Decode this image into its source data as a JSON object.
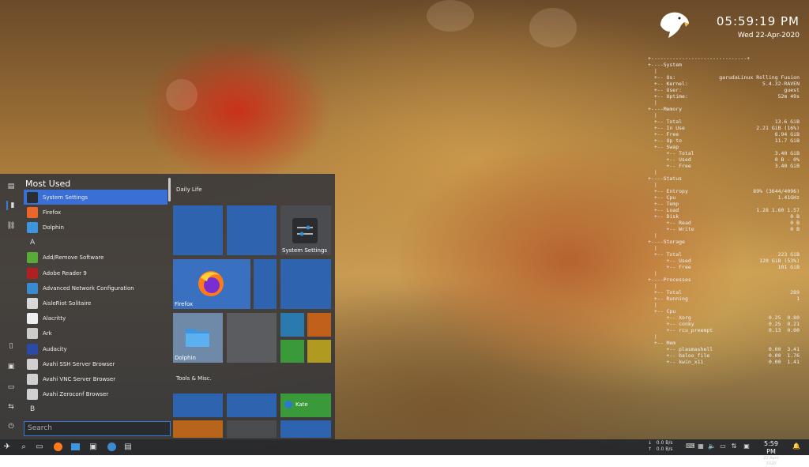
{
  "desktop": {
    "clock_time": "05:59:19 PM",
    "clock_date": "Wed 22-Apr-2020"
  },
  "conky": {
    "rows": [
      {
        "l": "+-------------------------------+",
        "r": ""
      },
      {
        "l": "+----System",
        "r": ""
      },
      {
        "l": "  |",
        "r": ""
      },
      {
        "l": "  +-- Os:",
        "r": "garudaLinux Rolling Fusion"
      },
      {
        "l": "  +-- Kernel:",
        "r": "5.4.32-RAVEN"
      },
      {
        "l": "  +-- User:",
        "r": "guest"
      },
      {
        "l": "  +-- Uptime:",
        "r": "52m 49s"
      },
      {
        "l": "  |",
        "r": ""
      },
      {
        "l": "+----Memory",
        "r": ""
      },
      {
        "l": "  |",
        "r": ""
      },
      {
        "l": "  +-- Total",
        "r": "13.6 GiB"
      },
      {
        "l": "  +-- In Use",
        "r": "2.21 GiB (16%)"
      },
      {
        "l": "  +-- Free",
        "r": "6.94 GiB"
      },
      {
        "l": "  +-- Up to",
        "r": "11.7 GiB"
      },
      {
        "l": "  +-- Swap",
        "r": ""
      },
      {
        "l": "      +-- Total",
        "r": "3.40 GiB"
      },
      {
        "l": "      +-- Used",
        "r": "0 B - 0%"
      },
      {
        "l": "      +-- Free",
        "r": "3.40 GiB"
      },
      {
        "l": "  |",
        "r": ""
      },
      {
        "l": "+----Status",
        "r": ""
      },
      {
        "l": "  |",
        "r": ""
      },
      {
        "l": "  +-- Entropy",
        "r": "89% (3644/4096)"
      },
      {
        "l": "  +-- Cpu",
        "r": "1.41GHz"
      },
      {
        "l": "  +-- Temp",
        "r": ""
      },
      {
        "l": "  +-- Load",
        "r": "1.28 1.60 1.57"
      },
      {
        "l": "  +-- Disk",
        "r": "0 B"
      },
      {
        "l": "      +-- Read",
        "r": "0 B"
      },
      {
        "l": "      +-- Write",
        "r": "0 B"
      },
      {
        "l": "  |",
        "r": ""
      },
      {
        "l": "+----Storage",
        "r": ""
      },
      {
        "l": "  |",
        "r": ""
      },
      {
        "l": "  +-- Total",
        "r": "223 GiB"
      },
      {
        "l": "      +-- Used",
        "r": "120 GiB (53%)"
      },
      {
        "l": "      +-- Free",
        "r": "101 GiB"
      },
      {
        "l": "  |",
        "r": ""
      },
      {
        "l": "+----Processes",
        "r": ""
      },
      {
        "l": "  |",
        "r": ""
      },
      {
        "l": "  +-- Total",
        "r": "289"
      },
      {
        "l": "  +-- Running",
        "r": "1"
      },
      {
        "l": "  |",
        "r": ""
      },
      {
        "l": "  +-- Cpu",
        "r": ""
      },
      {
        "l": "      +-- Xorg",
        "r": "0.25  0.80"
      },
      {
        "l": "      +-- conky",
        "r": "0.25  0.21"
      },
      {
        "l": "      +-- rcu_preempt",
        "r": "0.13  0.00"
      },
      {
        "l": "  |",
        "r": ""
      },
      {
        "l": "  +-- Mem",
        "r": ""
      },
      {
        "l": "      +-- plasmashell",
        "r": "0.00  3.41"
      },
      {
        "l": "      +-- baloo_file",
        "r": "0.00  1.76"
      },
      {
        "l": "      +-- kwin_x11",
        "r": "0.00  1.41"
      }
    ]
  },
  "menu": {
    "heading": "Most Used",
    "search_placeholder": "Search",
    "apps": [
      {
        "label": "System Settings",
        "color": "#2b2d30",
        "selected": true
      },
      {
        "label": "Firefox",
        "color": "#e8672a"
      },
      {
        "label": "Dolphin",
        "color": "#3d95e0"
      },
      {
        "letter": "A"
      },
      {
        "label": "Add/Remove Software",
        "color": "#5aaa3a"
      },
      {
        "label": "Adobe Reader 9",
        "color": "#b02020"
      },
      {
        "label": "Advanced Network Configuration",
        "color": "#3a8ad0"
      },
      {
        "label": "AisleRiot Solitaire",
        "color": "#d8d8d8"
      },
      {
        "label": "Alacritty",
        "color": "#eeeeee"
      },
      {
        "label": "Ark",
        "color": "#cccccc"
      },
      {
        "label": "Audacity",
        "color": "#2a4aa8"
      },
      {
        "label": "Avahi SSH Server Browser",
        "color": "#d0d0d0"
      },
      {
        "label": "Avahi VNC Server Browser",
        "color": "#d0d0d0"
      },
      {
        "label": "Avahi Zeroconf Browser",
        "color": "#d0d0d0"
      },
      {
        "letter": "B"
      }
    ],
    "tile_sections": [
      "Daily Life",
      "Tools & Misc."
    ],
    "tile_labels": {
      "system_settings": "System Settings",
      "firefox": "Firefox",
      "dolphin": "Dolphin",
      "kate": "Kate"
    }
  },
  "taskbar": {
    "net_down": "0.0 B/s",
    "net_up": "0.0 B/s",
    "time": "5:59 PM",
    "date": "22 April 2020"
  }
}
